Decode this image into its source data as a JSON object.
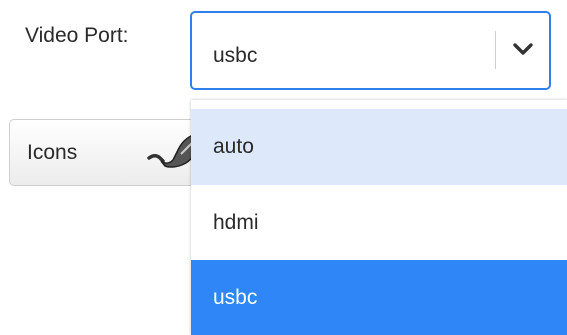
{
  "video_port": {
    "label": "Video Port:",
    "selected_value": "usbc",
    "options": [
      "auto",
      "hdmi",
      "usbc"
    ],
    "hovered_option": "auto",
    "chevron_icon": "chevron-down-icon"
  },
  "icons_button": {
    "label": "Icons",
    "icon": "pointing-hand-icon"
  },
  "colors": {
    "accent": "#2f80ed",
    "option_hover": "#dde8fb",
    "option_selected": "#2f86f6",
    "text": "#2a2a2a"
  }
}
